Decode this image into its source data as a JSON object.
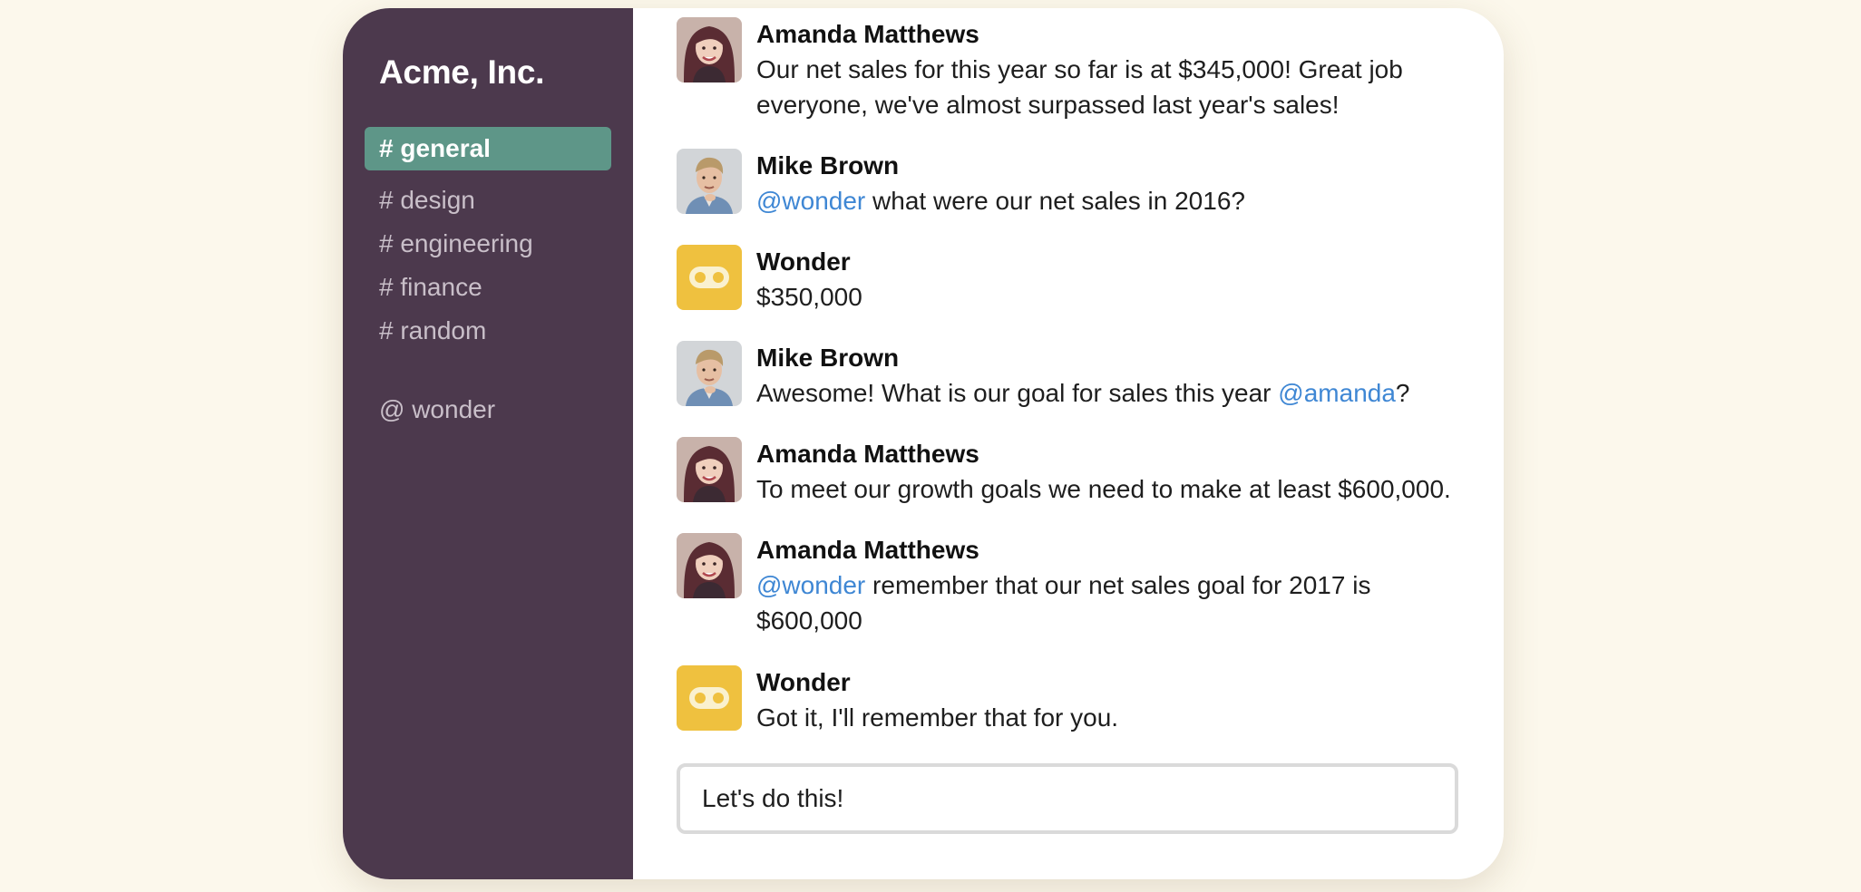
{
  "workspace": {
    "name": "Acme, Inc."
  },
  "sidebar": {
    "channels": [
      {
        "label": "# general",
        "active": true
      },
      {
        "label": "# design",
        "active": false
      },
      {
        "label": "# engineering",
        "active": false
      },
      {
        "label": "# finance",
        "active": false
      },
      {
        "label": "# random",
        "active": false
      }
    ],
    "direct_messages": [
      {
        "label": "@ wonder"
      }
    ]
  },
  "messages": [
    {
      "author": "Amanda Matthews",
      "avatar": "amanda-avatar",
      "text": "Our net sales for this year so far is at $345,000! Great job everyone, we've almost surpassed last year's sales!"
    },
    {
      "author": "Mike Brown",
      "avatar": "mike-avatar",
      "mention": "@wonder",
      "text": " what were our net sales in 2016?"
    },
    {
      "author": "Wonder",
      "avatar": "wonder-bot-icon",
      "text": "$350,000"
    },
    {
      "author": "Mike Brown",
      "avatar": "mike-avatar",
      "text": "Awesome! What is our goal for sales this year ",
      "mention": "@amanda",
      "text_after": "?"
    },
    {
      "author": "Amanda Matthews",
      "avatar": "amanda-avatar",
      "text": "To meet our growth goals we need to make at least $600,000."
    },
    {
      "author": "Amanda Matthews",
      "avatar": "amanda-avatar",
      "mention": "@wonder",
      "text": " remember that our net sales goal for 2017 is $600,000"
    },
    {
      "author": "Wonder",
      "avatar": "wonder-bot-icon",
      "text": "Got it, I'll remember that for you."
    }
  ],
  "composer": {
    "value": "Let's do this!"
  },
  "colors": {
    "page_background": "#fcf8ec",
    "sidebar_background": "#4c394d",
    "active_channel": "#5e9688",
    "mention": "#3f87d4",
    "bot_avatar": "#efc13f"
  }
}
